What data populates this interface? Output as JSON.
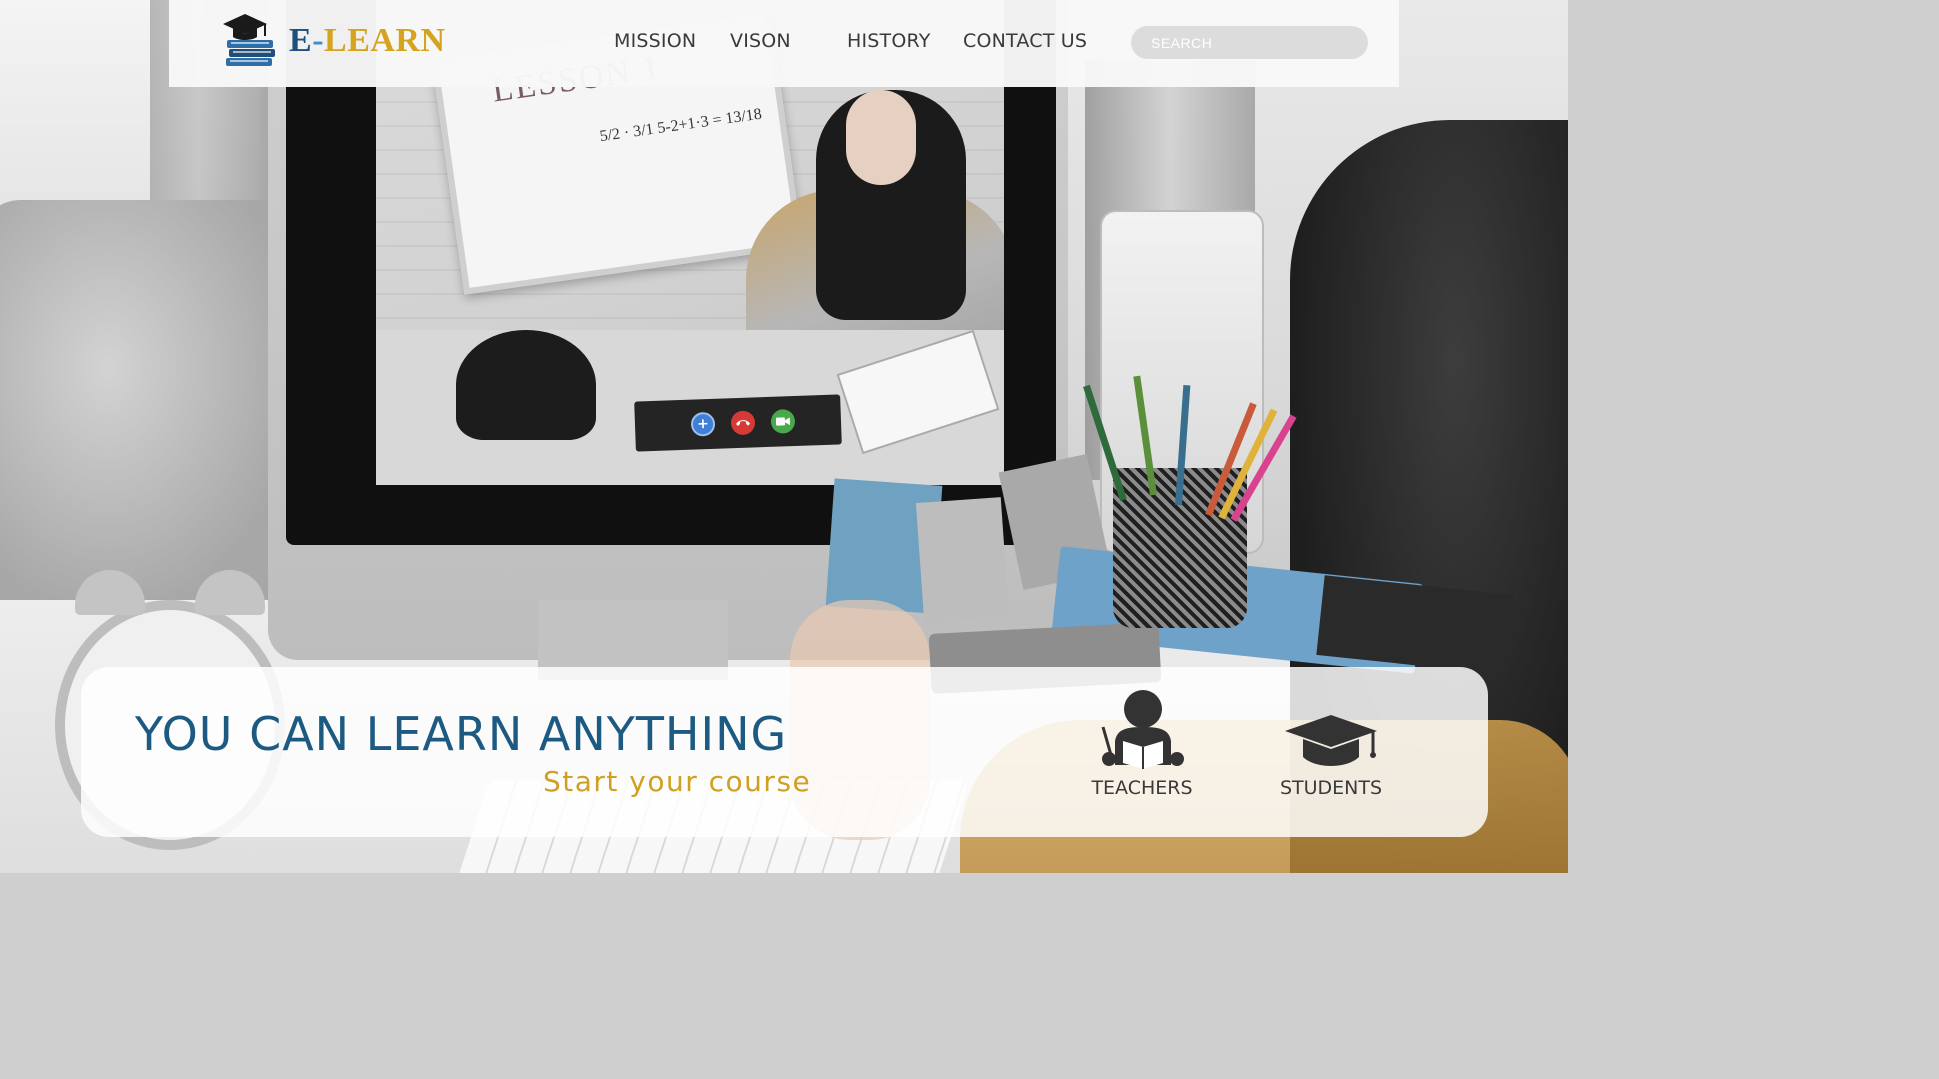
{
  "header": {
    "brand": {
      "e": "E",
      "dash": "-",
      "learn": "LEARN"
    },
    "nav": [
      "MISSION",
      "VISON",
      "HISTORY",
      "CONTACT US"
    ],
    "search_placeholder": "SEARCH"
  },
  "screen": {
    "board_title": "LESSON 1",
    "board_math": "5/2 · 3/1 5-2+1·3 = 13/18"
  },
  "hero": {
    "title": "YOU CAN LEARN ANYTHING",
    "subtitle": "Start your course",
    "roles": [
      {
        "label": "TEACHERS",
        "icon": "teacher-reading-icon"
      },
      {
        "label": "STUDENTS",
        "icon": "graduation-cap-icon"
      }
    ]
  },
  "colors": {
    "brand_dark_blue": "#1f4f7b",
    "brand_light_blue": "#3f8fc6",
    "brand_gold": "#d6a31e",
    "hero_title_blue": "#1d5a82",
    "hero_subtitle_gold": "#cfa021",
    "call_add": "#3f7fd6",
    "call_hangup": "#d63a37",
    "call_video": "#49a84a"
  }
}
